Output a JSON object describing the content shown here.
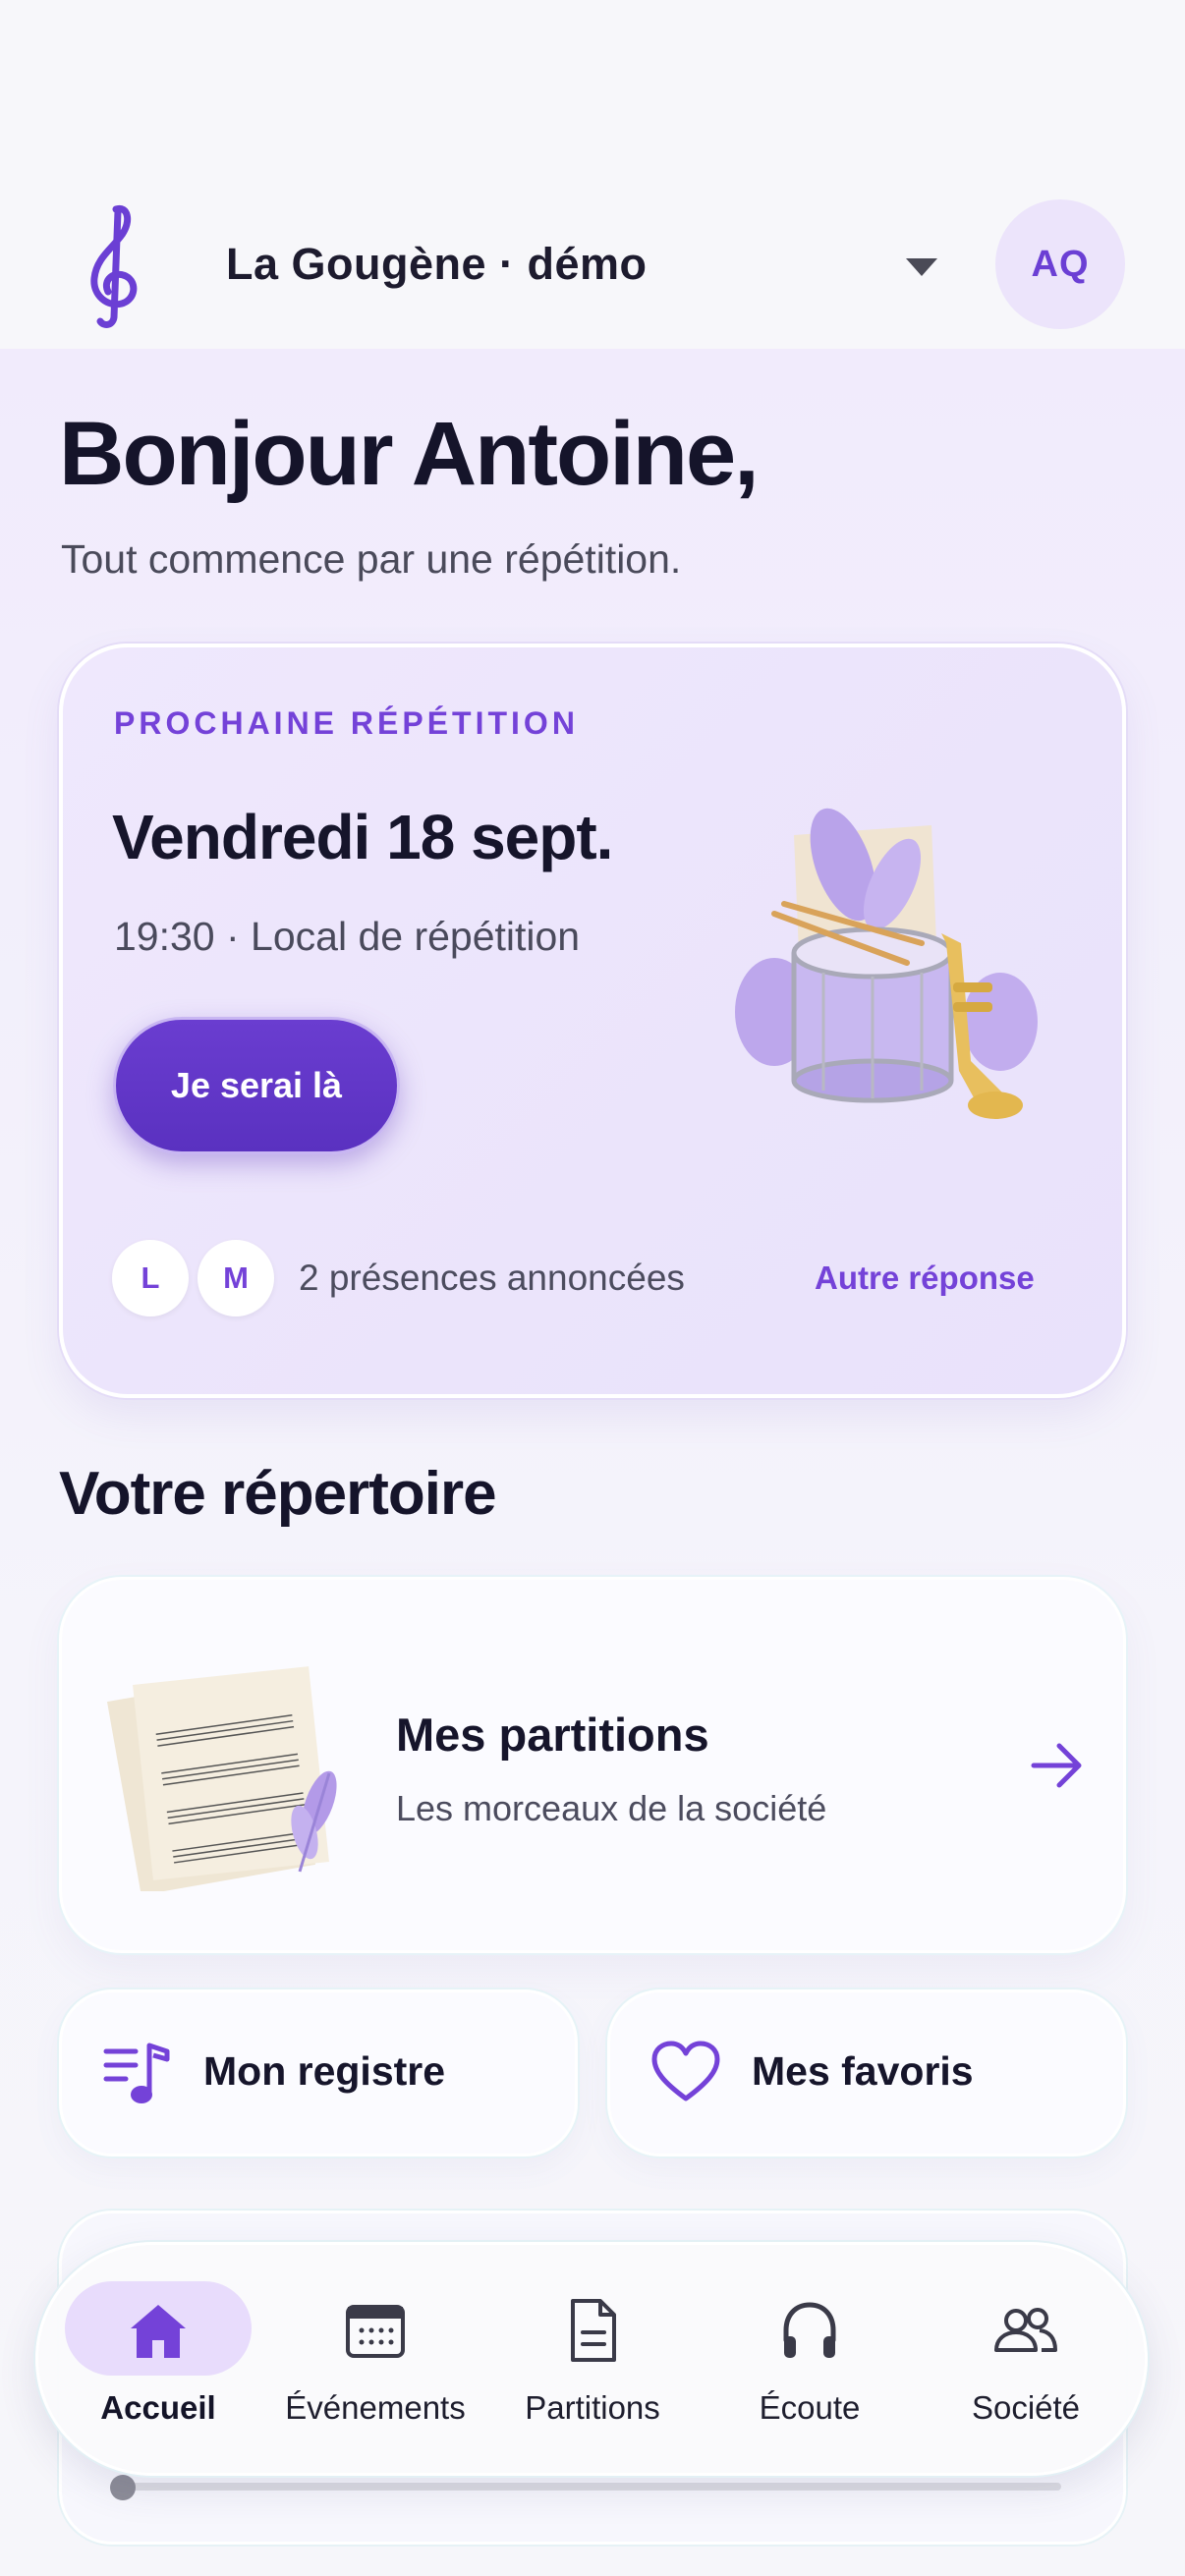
{
  "header": {
    "org_name": "La Gougène · démo",
    "avatar_initials": "AQ"
  },
  "greeting": {
    "title": "Bonjour Antoine,",
    "subtitle": "Tout commence par une répétition."
  },
  "next_rehearsal": {
    "eyebrow": "PROCHAINE RÉPÉTITION",
    "date": "Vendredi 18 sept.",
    "time_place": "19:30 · Local de répétition",
    "attend_button": "Je serai là",
    "attendee_initials": [
      "L",
      "M"
    ],
    "attendance_text": "2 présences annoncées",
    "other_answer": "Autre réponse"
  },
  "repertoire": {
    "section_title": "Votre répertoire",
    "scores_title": "Mes partitions",
    "scores_subtitle": "Les morceaux de la société",
    "register_label": "Mon registre",
    "favorites_label": "Mes favoris"
  },
  "player": {
    "progress": 0.0
  },
  "nav": {
    "items": [
      {
        "label": "Accueil",
        "icon": "home-icon",
        "active": true
      },
      {
        "label": "Événements",
        "icon": "calendar-icon",
        "active": false
      },
      {
        "label": "Partitions",
        "icon": "document-icon",
        "active": false
      },
      {
        "label": "Écoute",
        "icon": "headphones-icon",
        "active": false
      },
      {
        "label": "Société",
        "icon": "people-icon",
        "active": false
      }
    ]
  },
  "colors": {
    "accent": "#7442d8",
    "button": "#5f35c6",
    "active_nav_bg": "#e8dcfc"
  }
}
